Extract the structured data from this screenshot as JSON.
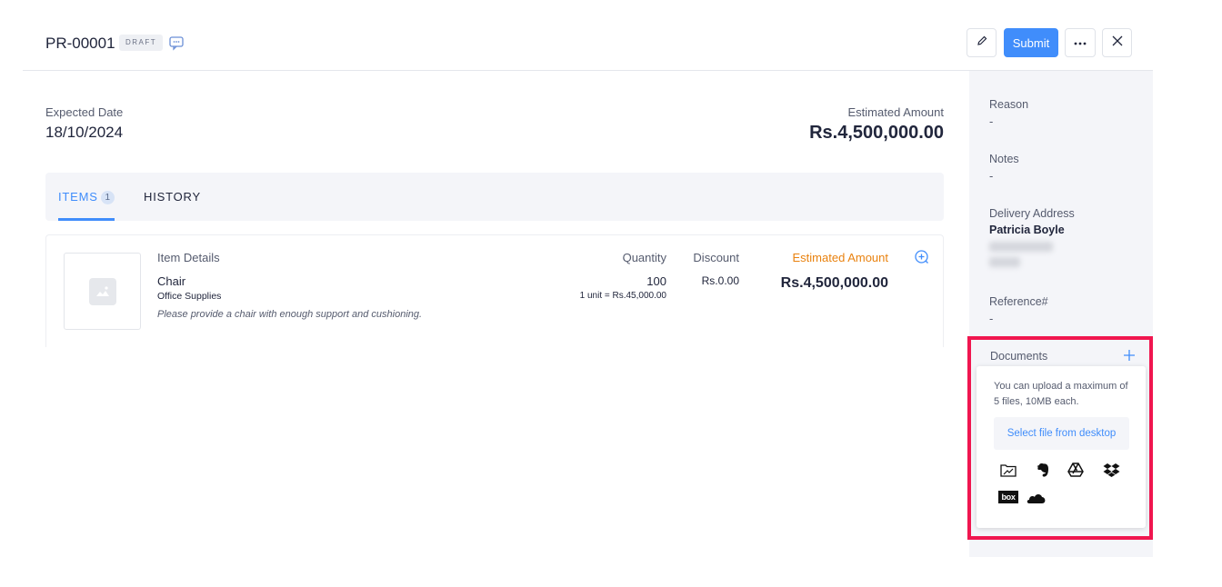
{
  "header": {
    "title": "PR-00001",
    "status_badge": "DRAFT",
    "submit_label": "Submit"
  },
  "summary": {
    "expected_date_label": "Expected Date",
    "expected_date": "18/10/2024",
    "estimated_amount_label": "Estimated Amount",
    "estimated_amount": "Rs.4,500,000.00"
  },
  "tabs": {
    "items_label": "ITEMS",
    "items_count": "1",
    "history_label": "HISTORY"
  },
  "items_table": {
    "headers": {
      "details": "Item Details",
      "quantity": "Quantity",
      "discount": "Discount",
      "estimated_amount": "Estimated Amount"
    },
    "rows": [
      {
        "name": "Chair",
        "category": "Office Supplies",
        "description": "Please provide a chair with enough support and cushioning.",
        "quantity": "100",
        "unit_price": "1 unit = Rs.45,000.00",
        "discount": "Rs.0.00",
        "amount": "Rs.4,500,000.00"
      }
    ]
  },
  "sidebar": {
    "reason_label": "Reason",
    "reason_value": "-",
    "notes_label": "Notes",
    "notes_value": "-",
    "delivery_label": "Delivery Address",
    "delivery_name": "Patricia Boyle",
    "reference_label": "Reference#",
    "reference_value": "-",
    "documents_label": "Documents"
  },
  "upload_popover": {
    "help_text": "You can upload a maximum of 5 files, 10MB each.",
    "select_label": "Select file from desktop",
    "sources": [
      "folder-icon",
      "evernote-icon",
      "google-drive-icon",
      "dropbox-icon",
      "box-icon",
      "onedrive-icon"
    ],
    "box_text": "box"
  },
  "colors": {
    "accent": "#408dfb",
    "highlight": "#f0164f",
    "estimated_header": "#e9820f"
  }
}
